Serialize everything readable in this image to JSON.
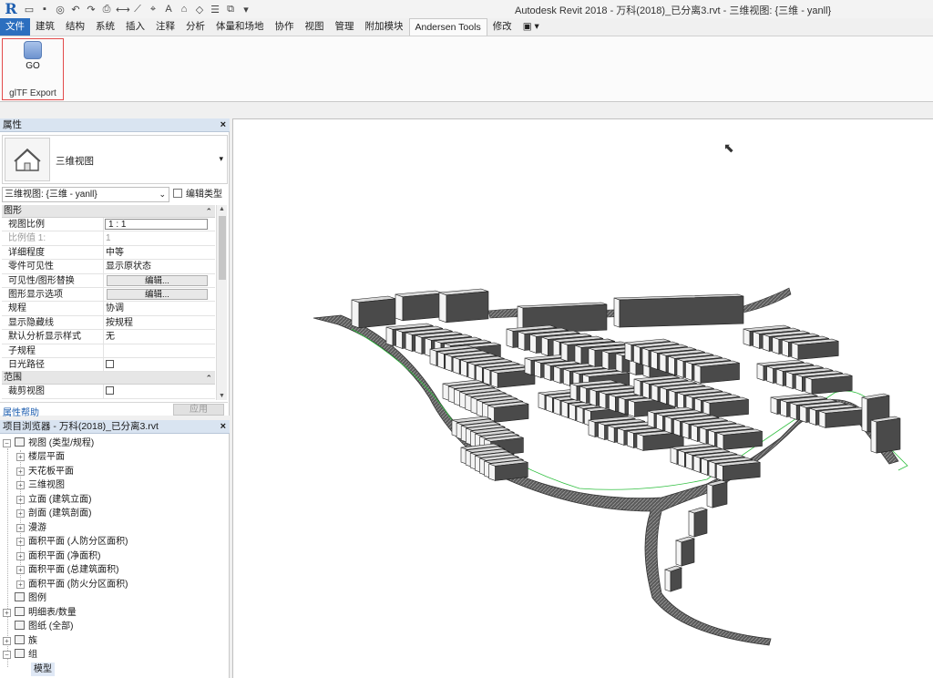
{
  "app": {
    "title": "Autodesk Revit 2018 -    万科(2018)_已分离3.rvt - 三维视图: {三维 - yanll}"
  },
  "ribbon": {
    "tabs": [
      "文件",
      "建筑",
      "结构",
      "系统",
      "插入",
      "注释",
      "分析",
      "体量和场地",
      "协作",
      "视图",
      "管理",
      "附加模块",
      "Andersen Tools",
      "修改",
      "▣ ▾"
    ],
    "active_tab": "Andersen Tools",
    "go_label": "GO",
    "group_label": "glTF Export"
  },
  "properties": {
    "header": "属性",
    "type_name": "三维视图",
    "instance_selector": "三维视图: {三维 - yanll}",
    "edit_type": "编辑类型",
    "sections": {
      "graphics": "图形",
      "extents": "范围"
    },
    "rows": [
      {
        "k": "视图比例",
        "v": "1 : 1"
      },
      {
        "k": "比例值 1:",
        "v": "1"
      },
      {
        "k": "详细程度",
        "v": "中等"
      },
      {
        "k": "零件可见性",
        "v": "显示原状态"
      },
      {
        "k": "可见性/图形替换",
        "v": "编辑..."
      },
      {
        "k": "图形显示选项",
        "v": "编辑..."
      },
      {
        "k": "规程",
        "v": "协调"
      },
      {
        "k": "显示隐藏线",
        "v": "按规程"
      },
      {
        "k": "默认分析显示样式",
        "v": "无"
      },
      {
        "k": "子规程",
        "v": ""
      },
      {
        "k": "日光路径",
        "v": ""
      }
    ],
    "crop_row": "裁剪视图",
    "help": "属性帮助",
    "apply": "应用"
  },
  "browser": {
    "header": "项目浏览器 - 万科(2018)_已分离3.rvt",
    "items": [
      "视图 (类型/规程)",
      "楼层平面",
      "天花板平面",
      "三维视图",
      "立面 (建筑立面)",
      "剖面 (建筑剖面)",
      "漫游",
      "面积平面 (人防分区面积)",
      "面积平面 (净面积)",
      "面积平面 (总建筑面积)",
      "面积平面 (防火分区面积)",
      "图例",
      "明细表/数量",
      "图纸 (全部)",
      "族",
      "组",
      "模型"
    ]
  }
}
